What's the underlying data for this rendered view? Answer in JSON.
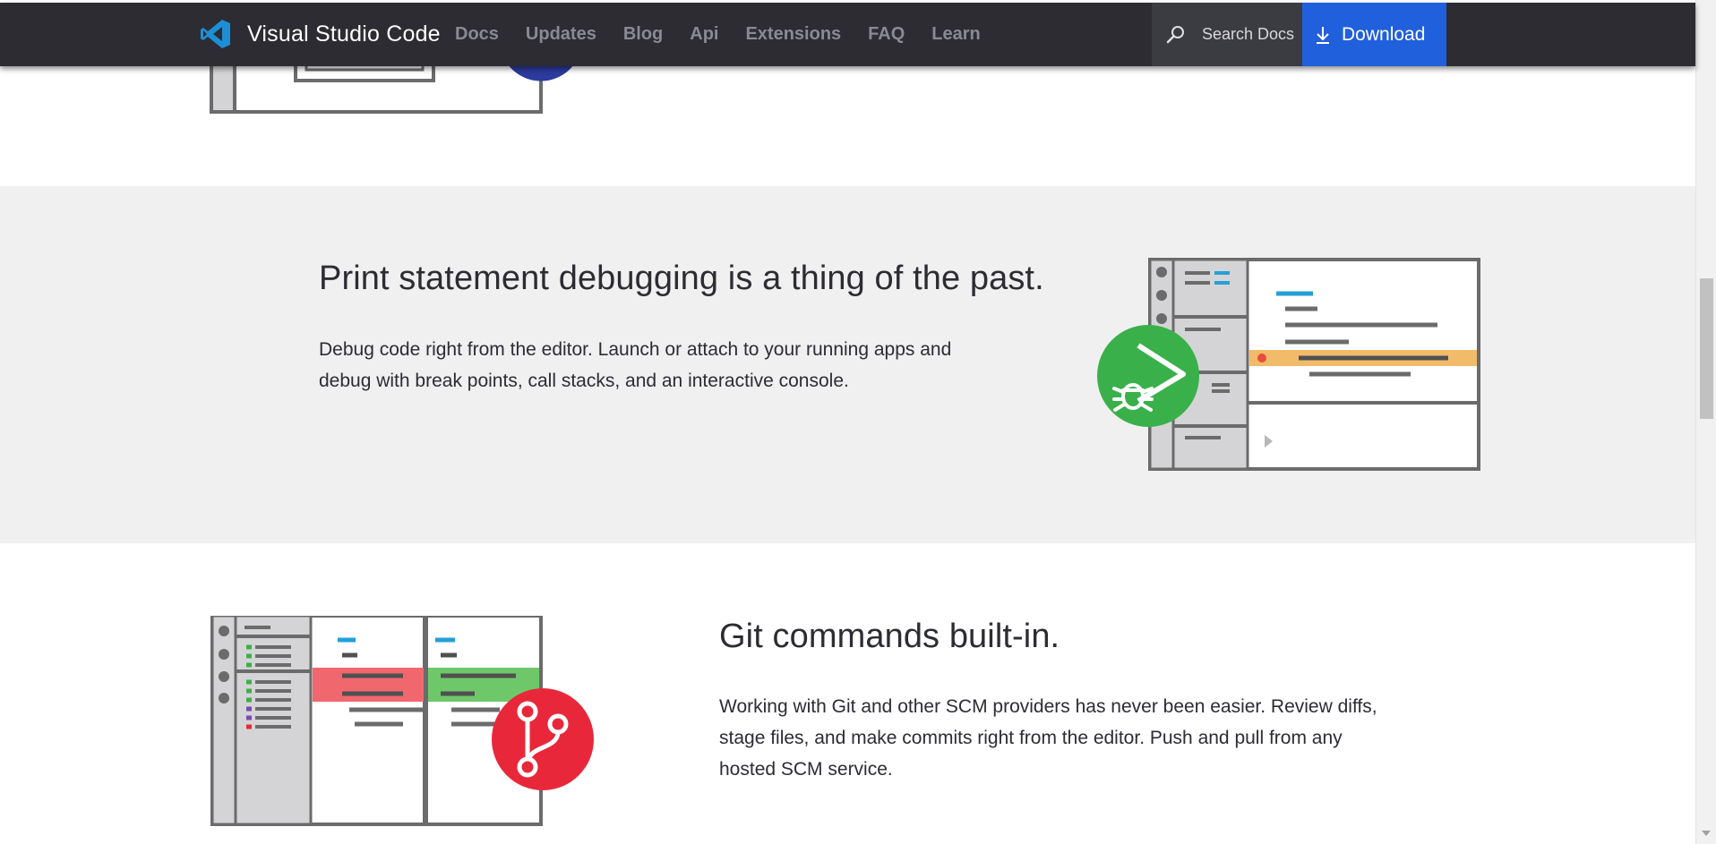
{
  "header": {
    "brand_name": "Visual Studio Code",
    "brand_icon": "vscode-logo-icon",
    "nav_items": [
      "Docs",
      "Updates",
      "Blog",
      "Api",
      "Extensions",
      "FAQ",
      "Learn"
    ],
    "search_label": "Search Docs",
    "download_label": "Download",
    "colors": {
      "bar": "#2c2c32",
      "download": "#2160dc",
      "nav_text": "#8a8a92"
    }
  },
  "debug_feature": {
    "title": "Print statement debugging is a thing of the past.",
    "description_line1": "Debug code right from the editor. Launch or attach to your running apps and",
    "description_line2": "debug with break points, call stacks, and an interactive console.",
    "icon": "debug-play-icon",
    "accent": "#3ab04a"
  },
  "git_feature": {
    "title": "Git commands built-in.",
    "description_line1": "Working with Git and other SCM providers has never been easier. Review diffs,",
    "description_line2": "stage files, and make commits right from the editor. Push and pull from any",
    "description_line3": "hosted SCM service.",
    "icon": "git-branch-icon",
    "accent": "#e8283a"
  }
}
